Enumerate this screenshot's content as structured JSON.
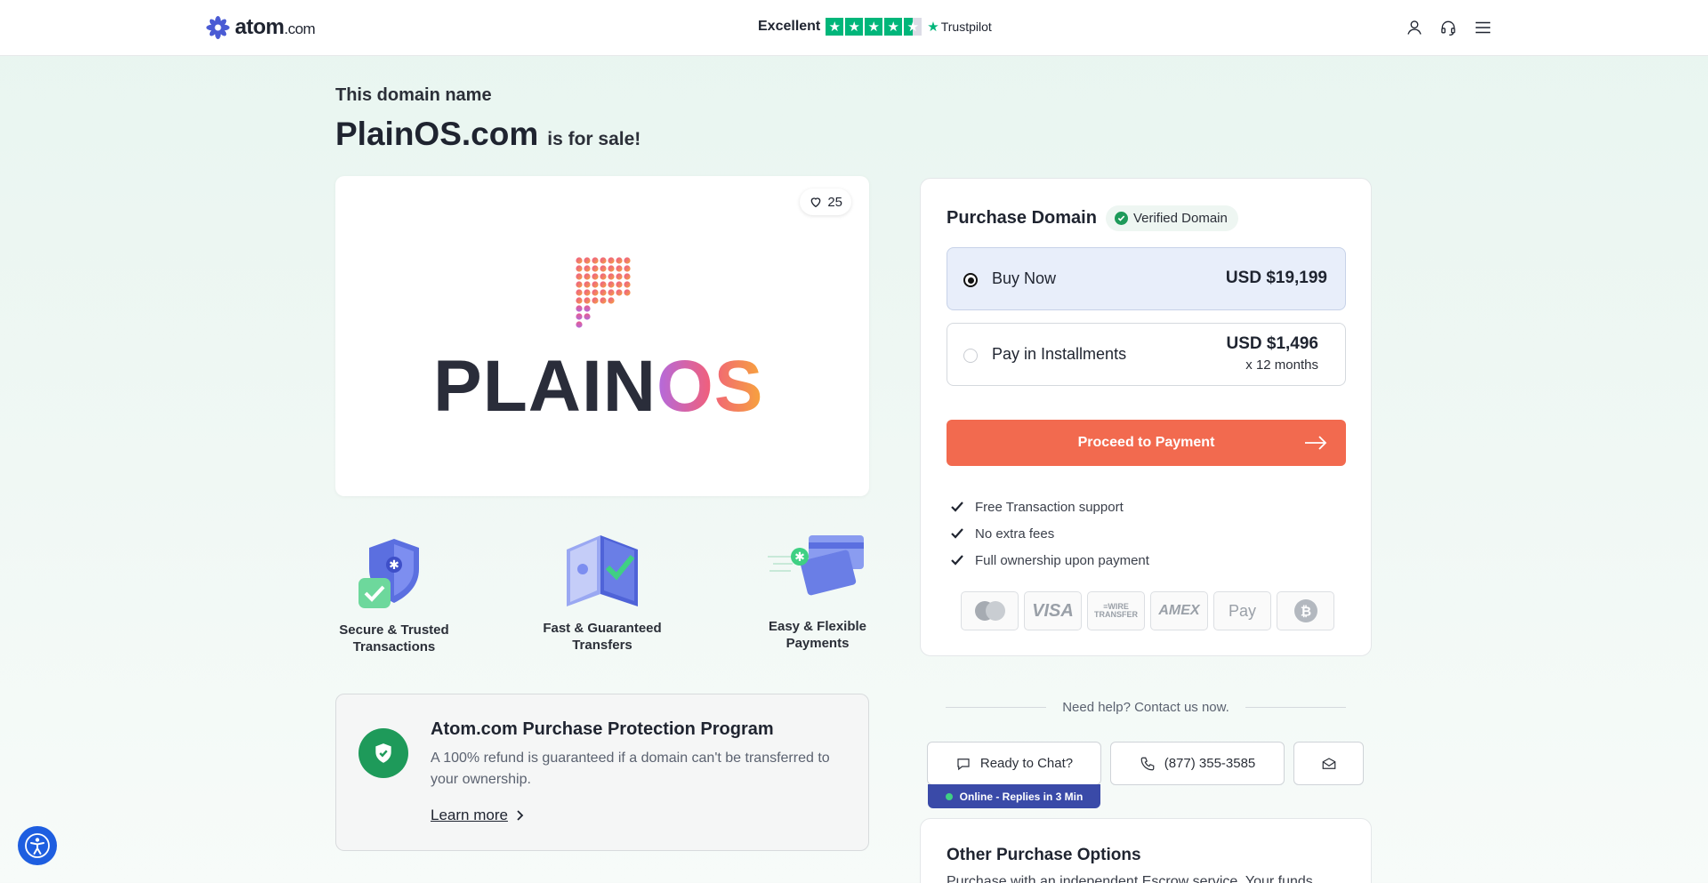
{
  "header": {
    "logo_text": "atom",
    "logo_tld": ".com",
    "trust_label": "Excellent",
    "trust_rating_stars": 4.5,
    "trustpilot": "Trustpilot"
  },
  "page": {
    "subtitle": "This domain name",
    "domain": "PlainOS.com",
    "for_sale": "is for sale!"
  },
  "logo_card": {
    "likes": "25",
    "brand_word_main": "PLAIN",
    "brand_word_accent": "OS"
  },
  "features": [
    {
      "line1": "Secure & Trusted",
      "line2": "Transactions"
    },
    {
      "line1": "Fast & Guaranteed",
      "line2": "Transfers"
    },
    {
      "line1": "Easy & Flexible",
      "line2": "Payments"
    }
  ],
  "protection": {
    "title": "Atom.com Purchase Protection Program",
    "text": "A 100% refund is guaranteed if a domain can't be transferred to your ownership.",
    "learn_more": "Learn more"
  },
  "purchase": {
    "title": "Purchase Domain",
    "verified": "Verified Domain",
    "options": [
      {
        "label": "Buy Now",
        "price": "USD $19,199",
        "selected": true
      },
      {
        "label": "Pay in Installments",
        "price": "USD $1,496",
        "sub": "x 12 months",
        "selected": false
      }
    ],
    "proceed": "Proceed to Payment",
    "benefits": [
      "Free Transaction support",
      "No extra fees",
      "Full ownership upon payment"
    ],
    "payment_methods": [
      "mastercard",
      "VISA",
      "WIRE TRANSFER",
      "AMEX",
      "Apple Pay",
      "bitcoin"
    ]
  },
  "help": {
    "text": "Need help? Contact us now.",
    "chat": "Ready to Chat?",
    "online": "Online - Replies in 3 Min",
    "phone": "(877) 355-3585"
  },
  "other": {
    "title": "Other Purchase Options",
    "text": "Purchase with an independent Escrow service. Your funds"
  },
  "colors": {
    "accent": "#f26a4f",
    "verified_green": "#1e9a5a",
    "trust_green": "#00b67a",
    "online_bar": "#3a4aa8"
  }
}
